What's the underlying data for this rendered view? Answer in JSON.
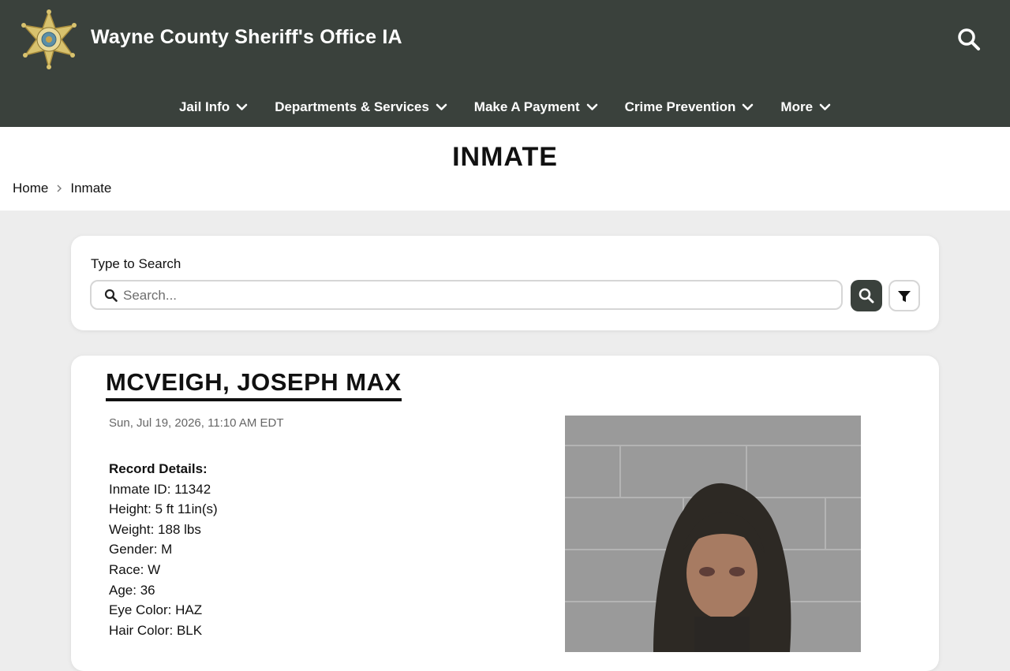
{
  "site": {
    "title": "Wayne County Sheriff's Office IA"
  },
  "nav": [
    {
      "label": "Jail Info"
    },
    {
      "label": "Departments & Services"
    },
    {
      "label": "Make A Payment"
    },
    {
      "label": "Crime Prevention"
    },
    {
      "label": "More"
    }
  ],
  "page": {
    "title": "INMATE",
    "breadcrumb": [
      "Home",
      "Inmate"
    ]
  },
  "search": {
    "label": "Type to Search",
    "placeholder": "Search..."
  },
  "record": {
    "name": "MCVEIGH, JOSEPH MAX",
    "timestamp": "Sun, Jul 19, 2026, 11:10 AM EDT",
    "details_heading": "Record Details:",
    "details": [
      "Inmate ID: 11342",
      "Height: 5 ft 11in(s)",
      "Weight: 188 lbs",
      "Gender: M",
      "Race: W",
      "Age: 36",
      "Eye Color: HAZ",
      "Hair Color: BLK"
    ]
  },
  "colors": {
    "header_bg": "#3a413c",
    "accent": "#3a413c",
    "page_bg": "#ededed"
  },
  "icons": {
    "logo": "sheriff-star-badge",
    "header_search": "search-icon",
    "nav_chevron": "chevron-down-icon",
    "breadcrumb_separator": "chevron-right-icon",
    "search_button": "search-icon",
    "filter_button": "filter-icon"
  }
}
